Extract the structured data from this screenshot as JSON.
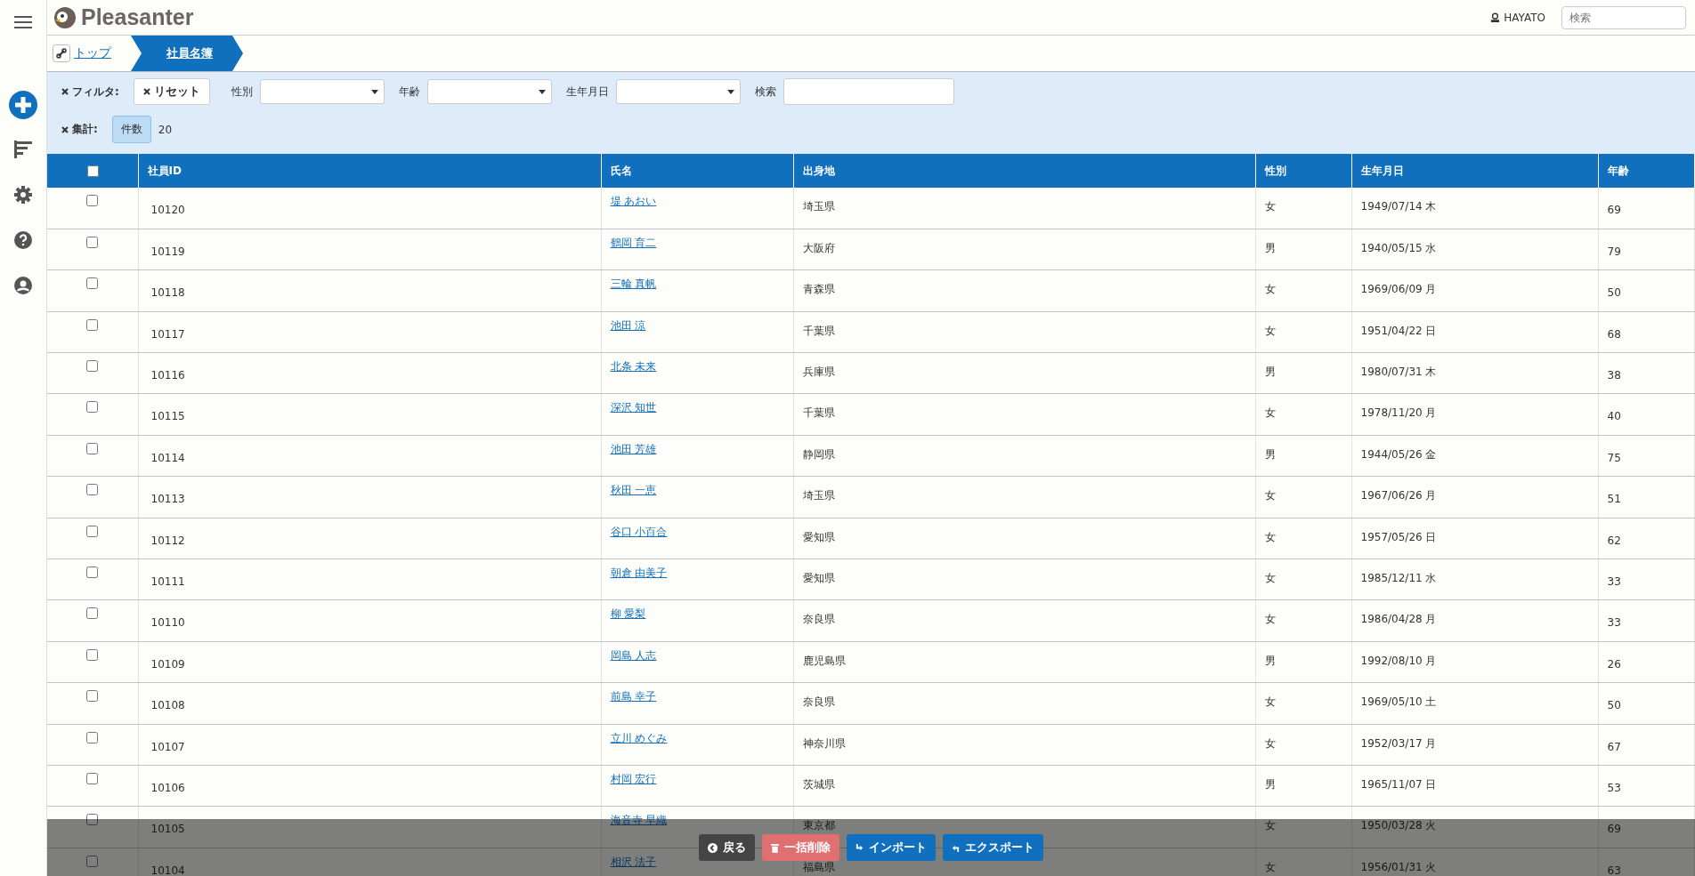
{
  "header": {
    "logo": "Pleasanter",
    "user": "HAYATO",
    "search": {
      "placeholder": "検索"
    }
  },
  "breadcrumb": [
    {
      "label": "トップ",
      "selected": false
    },
    {
      "label": "社員名簿",
      "selected": true
    }
  ],
  "filters": {
    "label": "フィルタ:",
    "reset": "リセット",
    "fields": [
      {
        "label": "性別",
        "kind": "select"
      },
      {
        "label": "年齢",
        "kind": "select"
      },
      {
        "label": "生年月日",
        "kind": "select"
      },
      {
        "label": "検索",
        "kind": "text"
      }
    ]
  },
  "aggregation": {
    "label": "集計:",
    "type": "件数",
    "count": "20"
  },
  "table": {
    "select_all": {
      "checked": false
    },
    "columns": [
      "社員ID",
      "氏名",
      "出身地",
      "性別",
      "生年月日",
      "年齢"
    ],
    "rows": [
      {
        "checked": false,
        "cells": [
          "10120",
          "堤 あおい",
          "埼玉県",
          "女",
          "1949/07/14 木",
          "69"
        ]
      },
      {
        "checked": false,
        "cells": [
          "10119",
          "鶴岡 育二",
          "大阪府",
          "男",
          "1940/05/15 水",
          "79"
        ]
      },
      {
        "checked": false,
        "cells": [
          "10118",
          "三輪 真帆",
          "青森県",
          "女",
          "1969/06/09 月",
          "50"
        ]
      },
      {
        "checked": false,
        "cells": [
          "10117",
          "池田 涼",
          "千葉県",
          "女",
          "1951/04/22 日",
          "68"
        ]
      },
      {
        "checked": false,
        "cells": [
          "10116",
          "北条 未来",
          "兵庫県",
          "男",
          "1980/07/31 木",
          "38"
        ]
      },
      {
        "checked": false,
        "cells": [
          "10115",
          "深沢 知世",
          "千葉県",
          "女",
          "1978/11/20 月",
          "40"
        ]
      },
      {
        "checked": false,
        "cells": [
          "10114",
          "池田 芳雄",
          "静岡県",
          "男",
          "1944/05/26 金",
          "75"
        ]
      },
      {
        "checked": false,
        "cells": [
          "10113",
          "秋田 一恵",
          "埼玉県",
          "女",
          "1967/06/26 月",
          "51"
        ]
      },
      {
        "checked": false,
        "cells": [
          "10112",
          "谷口 小百合",
          "愛知県",
          "女",
          "1957/05/26 日",
          "62"
        ]
      },
      {
        "checked": false,
        "cells": [
          "10111",
          "朝倉 由美子",
          "愛知県",
          "女",
          "1985/12/11 水",
          "33"
        ]
      },
      {
        "checked": false,
        "cells": [
          "10110",
          "柳 愛梨",
          "奈良県",
          "女",
          "1986/04/28 月",
          "33"
        ]
      },
      {
        "checked": false,
        "cells": [
          "10109",
          "岡島 人志",
          "鹿児島県",
          "男",
          "1992/08/10 月",
          "26"
        ]
      },
      {
        "checked": false,
        "cells": [
          "10108",
          "前島 幸子",
          "奈良県",
          "女",
          "1969/05/10 土",
          "50"
        ]
      },
      {
        "checked": false,
        "cells": [
          "10107",
          "立川 めぐみ",
          "神奈川県",
          "女",
          "1952/03/17 月",
          "67"
        ]
      },
      {
        "checked": false,
        "cells": [
          "10106",
          "村岡 宏行",
          "茨城県",
          "男",
          "1965/11/07 日",
          "53"
        ]
      },
      {
        "checked": false,
        "cells": [
          "10105",
          "海音寺 早織",
          "東京都",
          "女",
          "1950/03/28 火",
          "69"
        ]
      },
      {
        "checked": false,
        "cells": [
          "10104",
          "相沢 法子",
          "福島県",
          "女",
          "1956/01/31 火",
          "63"
        ]
      }
    ]
  },
  "footer_buttons": [
    {
      "label": "戻る",
      "kind": "back"
    },
    {
      "label": "一括削除",
      "kind": "delete"
    },
    {
      "label": "インポート",
      "kind": "import"
    },
    {
      "label": "エクスポート",
      "kind": "export"
    }
  ]
}
